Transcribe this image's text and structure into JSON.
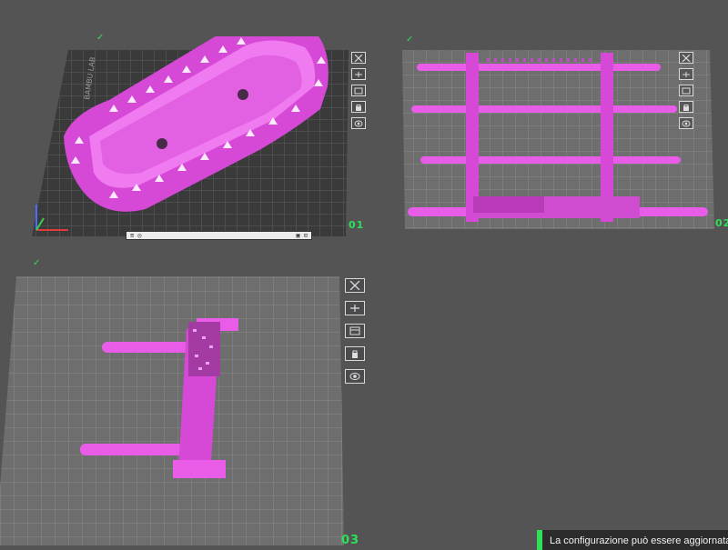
{
  "plates": [
    {
      "number": "01",
      "check": "✓",
      "label_text": "BAMBU LAB"
    },
    {
      "number": "02",
      "check": "✓"
    },
    {
      "number": "03",
      "check": "✓"
    }
  ],
  "plate_bar": {
    "left_text": "≡ ◎",
    "right_text": "▣ ⊡"
  },
  "toolbar_icons": [
    "close-icon",
    "auto-arrange-icon",
    "arrange-icon",
    "lock-icon",
    "eye-icon"
  ],
  "notification": {
    "text": "La configurazione può essere aggiornata"
  },
  "colors": {
    "model": "#e85ce8",
    "accent": "#2fe05a",
    "background": "#545455"
  }
}
